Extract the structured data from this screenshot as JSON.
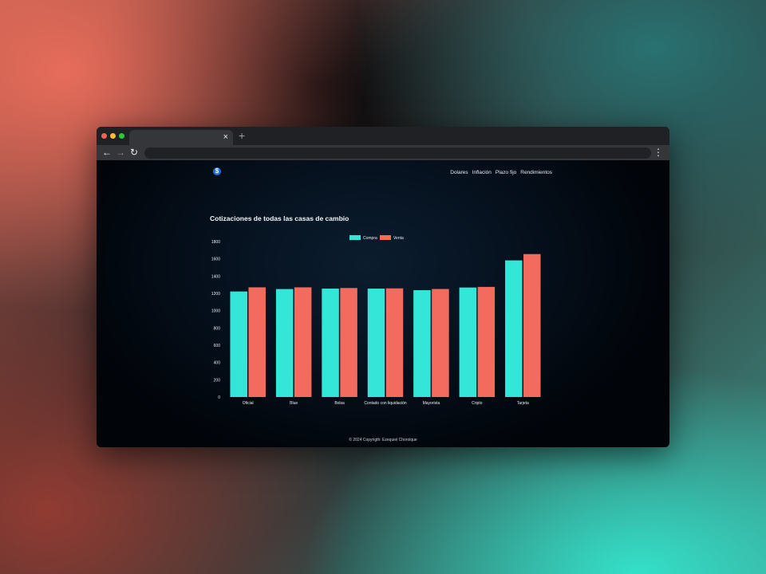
{
  "browser": {
    "tab_close_glyph": "×",
    "new_tab_glyph": "+",
    "back_glyph": "←",
    "forward_glyph": "→",
    "reload_glyph": "↻",
    "menu_glyph": "⋮"
  },
  "site": {
    "logo_glyph": "$",
    "nav": [
      "Dolares",
      "Inflación",
      "Plazo fijo",
      "Rendimientos"
    ]
  },
  "page": {
    "title": "Cotizaciones de todas las casas de cambio",
    "footer": "© 2024 Copyrigth: Ezequiel Chorolque"
  },
  "colors": {
    "compra": "#34e6d8",
    "venta": "#f36b5f",
    "logo": "#1f6fd6"
  },
  "chart_data": {
    "type": "bar",
    "categories": [
      "Oficial",
      "Blue",
      "Bolsa",
      "Contado con liquidación",
      "Mayorista",
      "Cripto",
      "Tarjeta"
    ],
    "series": [
      {
        "name": "Compra",
        "values": [
          1222,
          1250,
          1255,
          1255,
          1237,
          1268,
          1582
        ]
      },
      {
        "name": "Venta",
        "values": [
          1270,
          1270,
          1262,
          1258,
          1251,
          1275,
          1655
        ]
      }
    ],
    "ylim": [
      0,
      1800
    ],
    "yticks": [
      0,
      200,
      400,
      600,
      800,
      1000,
      1200,
      1400,
      1600,
      1800
    ],
    "legend": "top-center",
    "grid": false,
    "title": "",
    "xlabel": "",
    "ylabel": ""
  }
}
